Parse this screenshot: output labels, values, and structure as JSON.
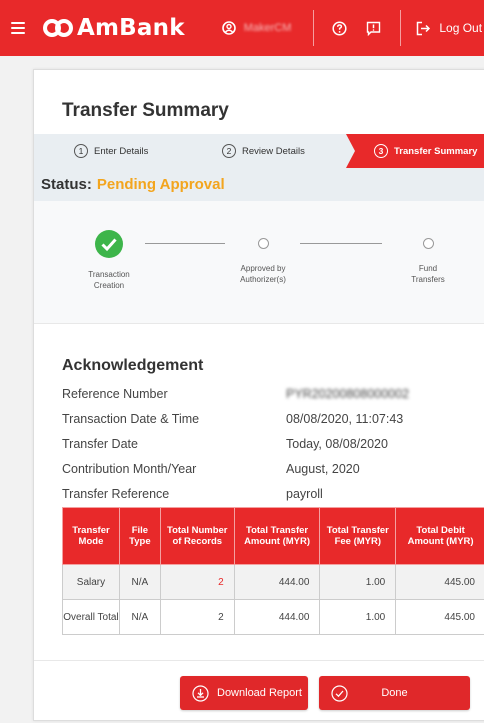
{
  "header": {
    "brand": "AmBank",
    "user_name": "MakerCM",
    "logout_label": "Log Out",
    "brand_color": "#e8292a"
  },
  "page": {
    "title": "Transfer Summary"
  },
  "steps": [
    {
      "num": "1",
      "label": "Enter Details"
    },
    {
      "num": "2",
      "label": "Review Details"
    },
    {
      "num": "3",
      "label": "Transfer Summary",
      "active": true
    }
  ],
  "status": {
    "label": "Status:",
    "value": "Pending Approval",
    "value_color": "#f3a51e"
  },
  "progress": [
    {
      "line1": "Transaction",
      "line2": "Creation",
      "done": true
    },
    {
      "line1": "Approved by",
      "line2": "Authorizer(s)",
      "done": false
    },
    {
      "line1": "Fund",
      "line2": "Transfers",
      "done": false
    }
  ],
  "acknowledgement": {
    "title": "Acknowledgement",
    "rows": [
      {
        "label": "Reference Number",
        "value": "PYR20200808000002"
      },
      {
        "label": "Transaction Date & Time",
        "value": "08/08/2020, 11:07:43"
      },
      {
        "label": "Transfer Date",
        "value": "Today, 08/08/2020"
      },
      {
        "label": "Contribution Month/Year",
        "value": "August, 2020"
      },
      {
        "label": "Transfer Reference",
        "value": "payroll"
      }
    ]
  },
  "table": {
    "headers": [
      "Transfer Mode",
      "File Type",
      "Total Number of Records",
      "Total Transfer Amount (MYR)",
      "Total Transfer Fee (MYR)",
      "Total Debit Amount (MYR)"
    ],
    "rows": [
      [
        "Salary",
        "N/A",
        "2",
        "444.00",
        "1.00",
        "445.00"
      ],
      [
        "Overall Total",
        "N/A",
        "2",
        "444.00",
        "1.00",
        "445.00"
      ]
    ]
  },
  "buttons": {
    "download": "Download Report",
    "done": "Done"
  }
}
